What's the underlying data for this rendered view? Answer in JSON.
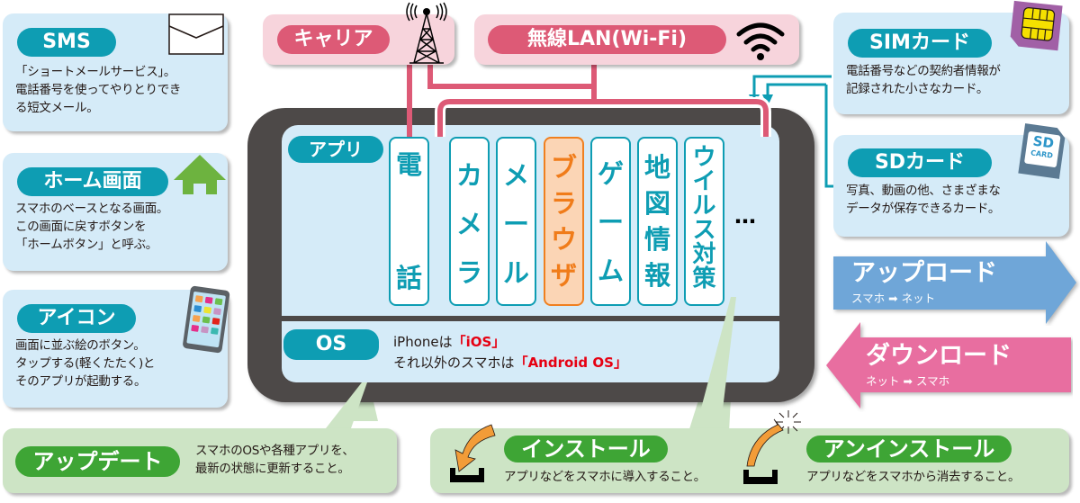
{
  "colors": {
    "teal": "#0e9db3",
    "rose": "#dd5a76",
    "green": "#3ea535",
    "orange": "#f07c1a",
    "phone_body": "#4d4948",
    "screen": "#d5ebf8",
    "upload_arrow": "#6fa6d8",
    "download_arrow": "#e86ea0",
    "highlight_red": "#e60012"
  },
  "left_boxes": {
    "sms": {
      "title": "SMS",
      "icon": "envelope-icon",
      "lines": [
        "「ショートメールサービス」。",
        "電話番号を使ってやりとりでき",
        "る短文メール。"
      ]
    },
    "home": {
      "title": "ホーム画面",
      "icon": "house-icon",
      "lines": [
        "スマホのベースとなる画面。",
        "この画面に戻すボタンを",
        "「ホームボタン」と呼ぶ。"
      ]
    },
    "icon": {
      "title": "アイコン",
      "icon": "tablet-icon",
      "lines": [
        "画面に並ぶ絵のボタン。",
        "タップする(軽くたたく)と",
        "そのアプリが起動する。"
      ]
    }
  },
  "top_boxes": {
    "carrier": {
      "title": "キャリア",
      "icon": "antenna-tower-icon"
    },
    "wifi": {
      "title": "無線LAN(Wi-Fi)",
      "icon": "wifi-icon"
    }
  },
  "right_boxes": {
    "sim": {
      "title": "SIMカード",
      "icon": "sim-card-icon",
      "lines": [
        "電話番号などの契約者情報が",
        "記録された小さなカード。"
      ]
    },
    "sd": {
      "title": "SDカード",
      "icon": "sd-card-icon",
      "icon_text": [
        "SD",
        "CARD"
      ],
      "lines": [
        "写真、動画の他、さまざまな",
        "データが保存できるカード。"
      ]
    }
  },
  "transfer": {
    "upload": {
      "title": "アップロード",
      "from": "スマホ",
      "to": "ネット"
    },
    "download": {
      "title": "ダウンロード",
      "from": "ネット",
      "to": "スマホ"
    },
    "arrow_glyph": "➡"
  },
  "phone": {
    "apps_label": "アプリ",
    "apps": [
      {
        "label": "電話",
        "chars": [
          "電",
          "",
          "",
          "話"
        ],
        "highlight": false
      },
      {
        "label": "カメラ",
        "chars": [
          "カ",
          "メ",
          "ラ"
        ],
        "highlight": false
      },
      {
        "label": "メール",
        "chars": [
          "メ",
          "ー",
          "ル"
        ],
        "highlight": false
      },
      {
        "label": "ブラウザ",
        "chars": [
          "ブ",
          "ラ",
          "ウ",
          "ザ"
        ],
        "highlight": true
      },
      {
        "label": "ゲーム",
        "chars": [
          "ゲ",
          "ー",
          "ム"
        ],
        "highlight": false
      },
      {
        "label": "地図情報",
        "chars": [
          "地",
          "図",
          "情",
          "報"
        ],
        "highlight": false
      },
      {
        "label": "ウイルス対策",
        "chars": [
          "ウ",
          "イ",
          "ル",
          "ス",
          "対",
          "策"
        ],
        "highlight": false
      }
    ],
    "more": "…",
    "os_label": "OS",
    "os_line1_prefix": "iPhoneは",
    "os_line1_value": "「iOS」",
    "os_line2_prefix": "それ以外のスマホは",
    "os_line2_value": "「Android OS」"
  },
  "bottom_boxes": {
    "update": {
      "title": "アップデート",
      "lines": [
        "スマホのOSや各種アプリを、",
        "最新の状態に更新すること。"
      ]
    },
    "install": {
      "title": "インストール",
      "icon": "install-arrow-icon",
      "description": "アプリなどをスマホに導入すること。"
    },
    "uninstall": {
      "title": "アンインストール",
      "icon": "uninstall-arrow-icon",
      "description": "アプリなどをスマホから消去すること。"
    }
  }
}
